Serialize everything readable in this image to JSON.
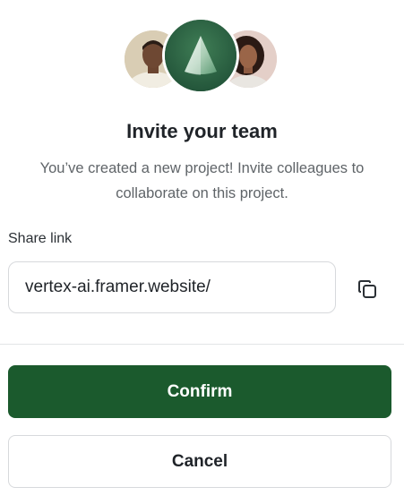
{
  "dialog": {
    "title": "Invite your team",
    "subtitle": "You’ve created a new project! Invite colleagues to collaborate on this project."
  },
  "share": {
    "label": "Share link",
    "value": "vertex-ai.framer.website/",
    "copy_icon": "copy-icon"
  },
  "actions": {
    "confirm_label": "Confirm",
    "cancel_label": "Cancel"
  },
  "avatars": [
    {
      "name": "team-member-avatar"
    },
    {
      "name": "app-logo-avatar"
    },
    {
      "name": "team-member-avatar"
    }
  ],
  "colors": {
    "primary": "#1b5a2d",
    "logo_bg": "#2f6a42",
    "border": "#d7d9dc",
    "text": "#1f2328",
    "muted_text": "#5f6468"
  }
}
